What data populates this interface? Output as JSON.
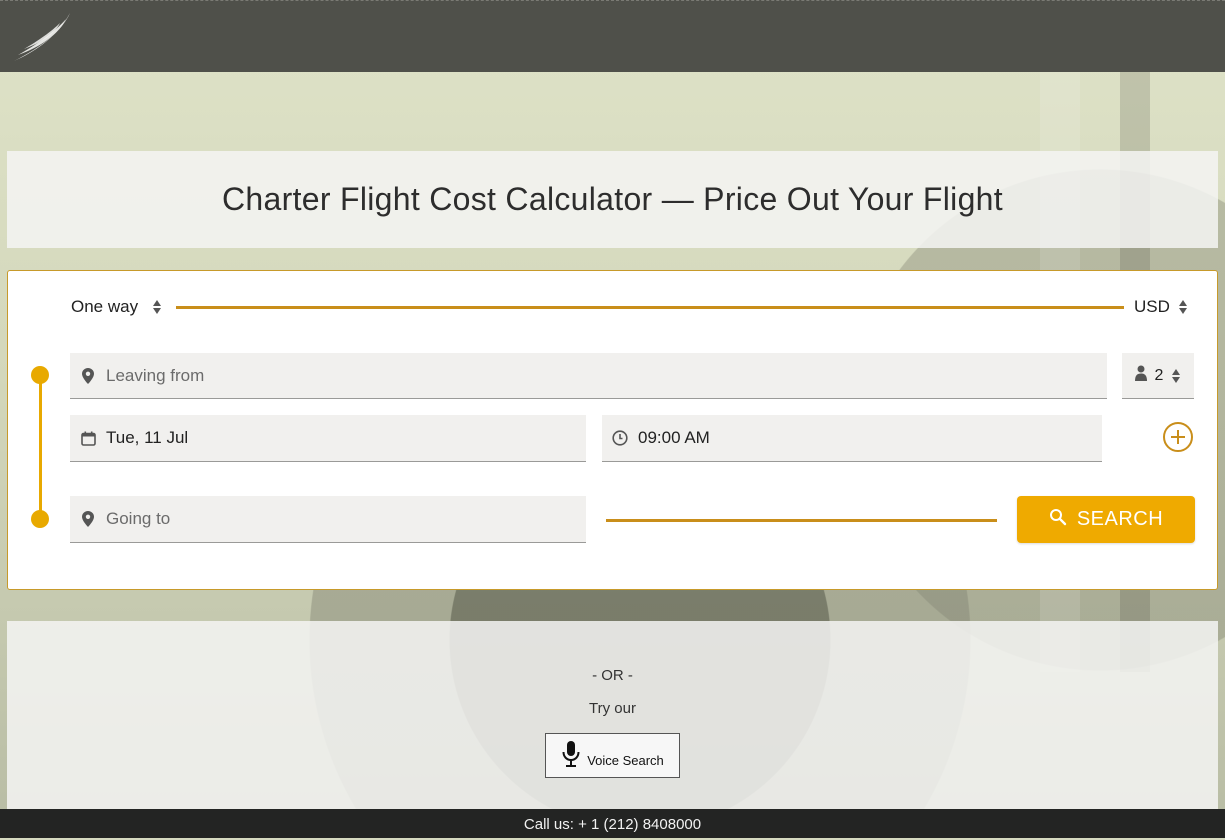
{
  "header": {
    "logo": "wing-logo"
  },
  "page": {
    "title": "Charter Flight Cost Calculator — Price Out Your Flight"
  },
  "form": {
    "trip_type": "One way",
    "currency": "USD",
    "leaving_from": {
      "placeholder": "Leaving from",
      "icon": "location-pin-icon"
    },
    "passengers": {
      "value": "2",
      "icon": "person-icon"
    },
    "date": {
      "value": "Tue, 11 Jul",
      "icon": "calendar-icon"
    },
    "time": {
      "value": "09:00 AM",
      "icon": "clock-icon"
    },
    "going_to": {
      "placeholder": "Going to",
      "icon": "location-pin-icon"
    },
    "add_leg_icon": "plus-circle-icon",
    "search_label": "SEARCH",
    "search_icon": "search-icon"
  },
  "alternative": {
    "or_text": "- OR -",
    "try_text": "Try our",
    "voice_label": "Voice Search",
    "voice_icon": "microphone-icon"
  },
  "footer": {
    "text": "Call us: + 1 (212) 8408000"
  },
  "colors": {
    "accent": "#efaa00",
    "line": "#c98e1a",
    "header": "#4f504a",
    "footer": "#232423"
  }
}
